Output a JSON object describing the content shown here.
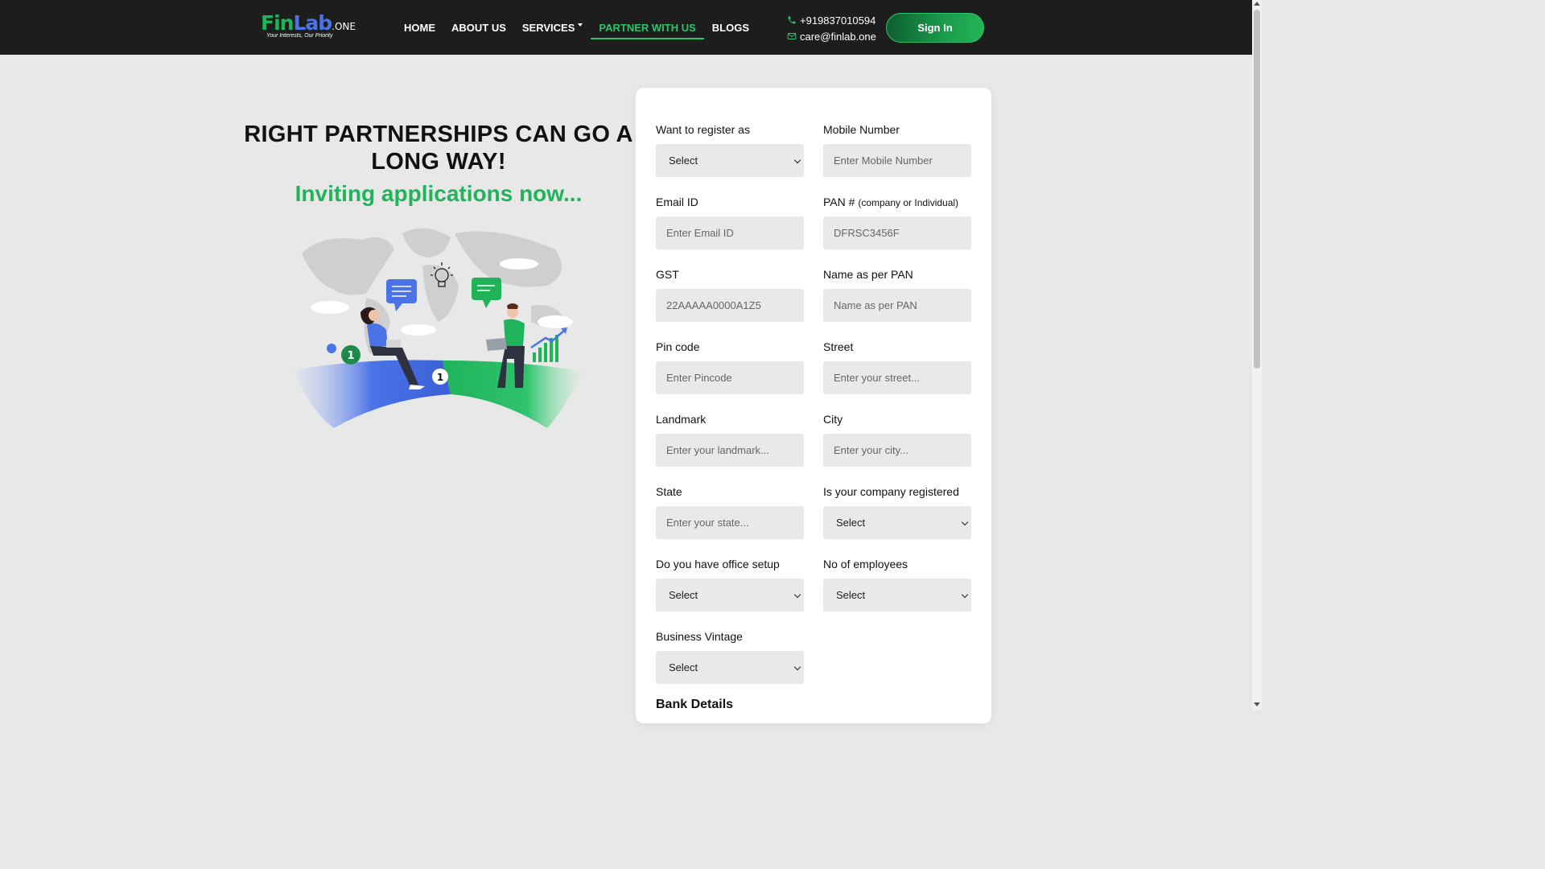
{
  "brand": {
    "fin": "Fin",
    "lab": "Lab",
    "one": ".ONE",
    "tagline": "Your Interests, Our Priority"
  },
  "nav": {
    "items": [
      {
        "label": "HOME"
      },
      {
        "label": "ABOUT US"
      },
      {
        "label": "SERVICES"
      },
      {
        "label": "PARTNER WITH US"
      },
      {
        "label": "BLOGS"
      }
    ],
    "phone": "+919837010594",
    "email": "care@finlab.one",
    "signin_label": "Sign In"
  },
  "hero": {
    "title": "RIGHT PARTNERSHIPS CAN GO A LONG WAY!",
    "subtitle": "Inviting applications now...",
    "badge_1": "1",
    "badge_2": "1"
  },
  "form": {
    "register_as": {
      "label": "Want to register as",
      "value": "Select"
    },
    "mobile": {
      "label": "Mobile Number",
      "placeholder": "Enter Mobile Number"
    },
    "email": {
      "label": "Email ID",
      "placeholder": "Enter Email ID"
    },
    "pan": {
      "label": "PAN #",
      "label_note": "(company or Individual)",
      "placeholder": "DFRSC3456F"
    },
    "gst": {
      "label": "GST",
      "placeholder": "22AAAAA0000A1Z5"
    },
    "name_pan": {
      "label": "Name as per PAN",
      "placeholder": "Name as per PAN"
    },
    "pincode": {
      "label": "Pin code",
      "placeholder": "Enter Pincode"
    },
    "street": {
      "label": "Street",
      "placeholder": "Enter your street..."
    },
    "landmark": {
      "label": "Landmark",
      "placeholder": "Enter your landmark..."
    },
    "city": {
      "label": "City",
      "placeholder": "Enter your city..."
    },
    "state": {
      "label": "State",
      "placeholder": "Enter your state..."
    },
    "company_registered": {
      "label": "Is your company registered",
      "value": "Select"
    },
    "office_setup": {
      "label": "Do you have office setup",
      "value": "Select"
    },
    "employees": {
      "label": "No of employees",
      "value": "Select"
    },
    "business_vintage": {
      "label": "Business Vintage",
      "value": "Select"
    },
    "bank_details_title": "Bank Details"
  },
  "colors": {
    "navbar_bg": "#1d1d1d",
    "accent_green": "#1fb35a",
    "accent_blue": "#4a73e8",
    "page_bg": "#e8e8e8",
    "input_bg": "#e9e9e9"
  }
}
